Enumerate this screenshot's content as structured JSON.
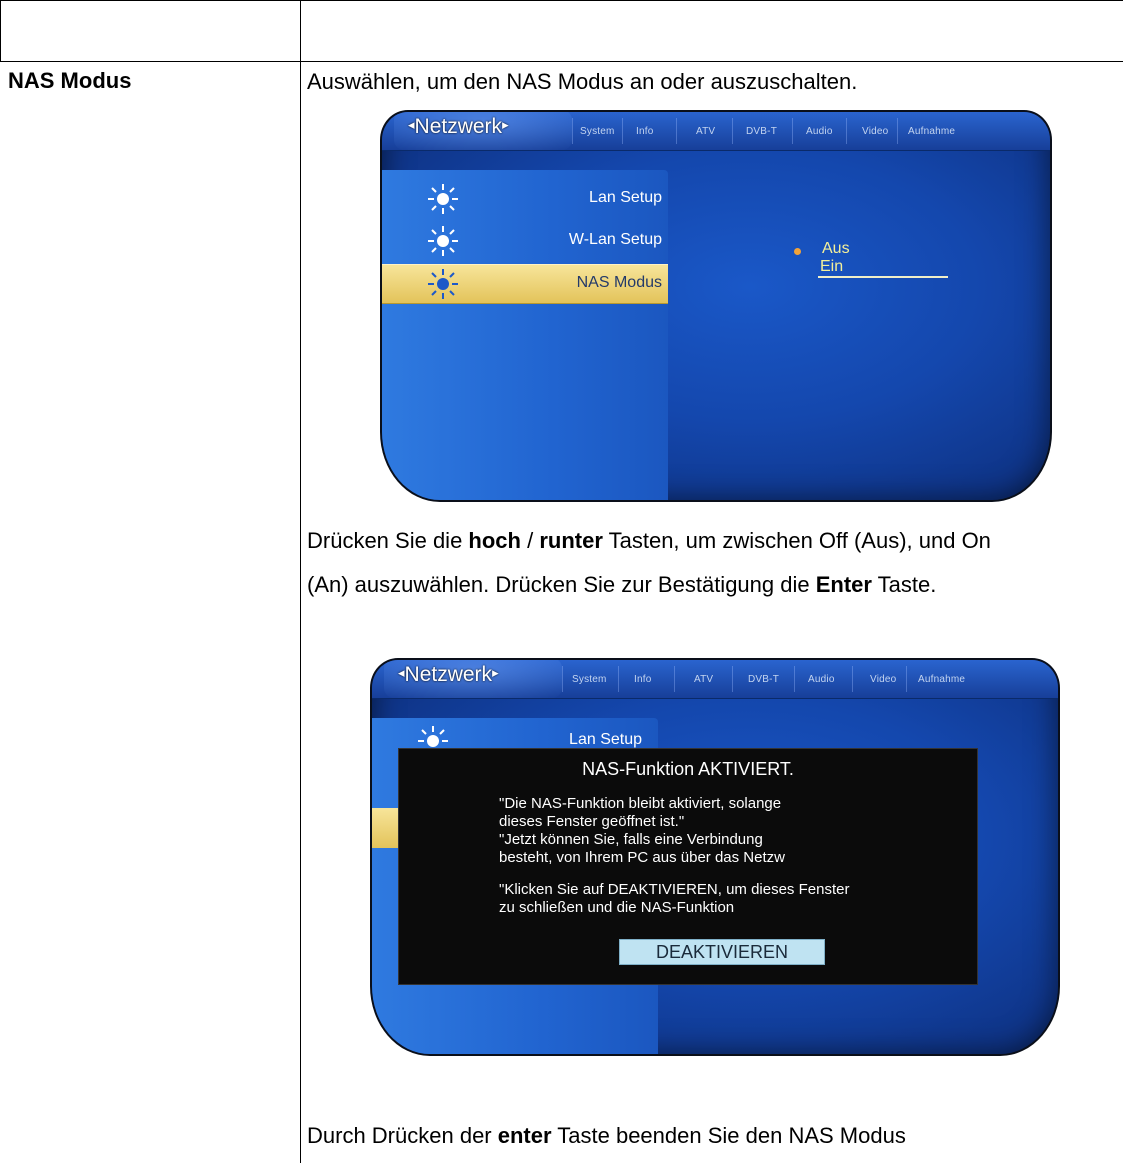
{
  "table": {
    "label": "NAS Modus"
  },
  "intro": "Auswählen, um den NAS Modus an oder auszuschalten.",
  "screen1": {
    "active_tab": "Netzwerk",
    "tabs": [
      "System",
      "Info",
      "ATV",
      "DVB-T",
      "Audio",
      "Video",
      "Aufnahme"
    ],
    "menu": [
      {
        "label": "Lan Setup",
        "icon": "sun-icon",
        "selected": false
      },
      {
        "label": "W-Lan Setup",
        "icon": "sun-icon",
        "selected": false
      },
      {
        "label": "NAS Modus",
        "icon": "sun-icon",
        "selected": true
      }
    ],
    "options": [
      "Aus",
      "Ein"
    ],
    "selected_option": "Aus"
  },
  "instruction": {
    "p1": "Drücken Sie die ",
    "b1": "hoch",
    "p2": " / ",
    "b2": "runter",
    "p3": " Tasten, um zwischen Off (Aus), und On",
    "line2a": "(An) auszuwählen. Drücken Sie zur Bestätigung die ",
    "b3": "Enter",
    "line2b": " Taste."
  },
  "screen2": {
    "active_tab": "Netzwerk",
    "tabs": [
      "System",
      "Info",
      "ATV",
      "DVB-T",
      "Audio",
      "Video",
      "Aufnahme"
    ],
    "menu_first": "Lan Setup",
    "dialog": {
      "title": "NAS-Funktion AKTIVIERT.",
      "lines": [
        "\"Die NAS-Funktion bleibt aktiviert, solange",
        "dieses Fenster geöffnet ist.\"",
        "\"Jetzt können Sie, falls eine Verbindung",
        "besteht, von Ihrem PC aus über das Netzw",
        "\"Klicken Sie auf DEAKTIVIEREN, um dieses Fenster",
        "zu schließen und die NAS-Funktion"
      ],
      "button": "DEAKTIVIEREN"
    }
  },
  "outro": {
    "p1": "Durch Drücken der ",
    "b1": "enter",
    "p2": " Taste beenden Sie den NAS Modus"
  }
}
